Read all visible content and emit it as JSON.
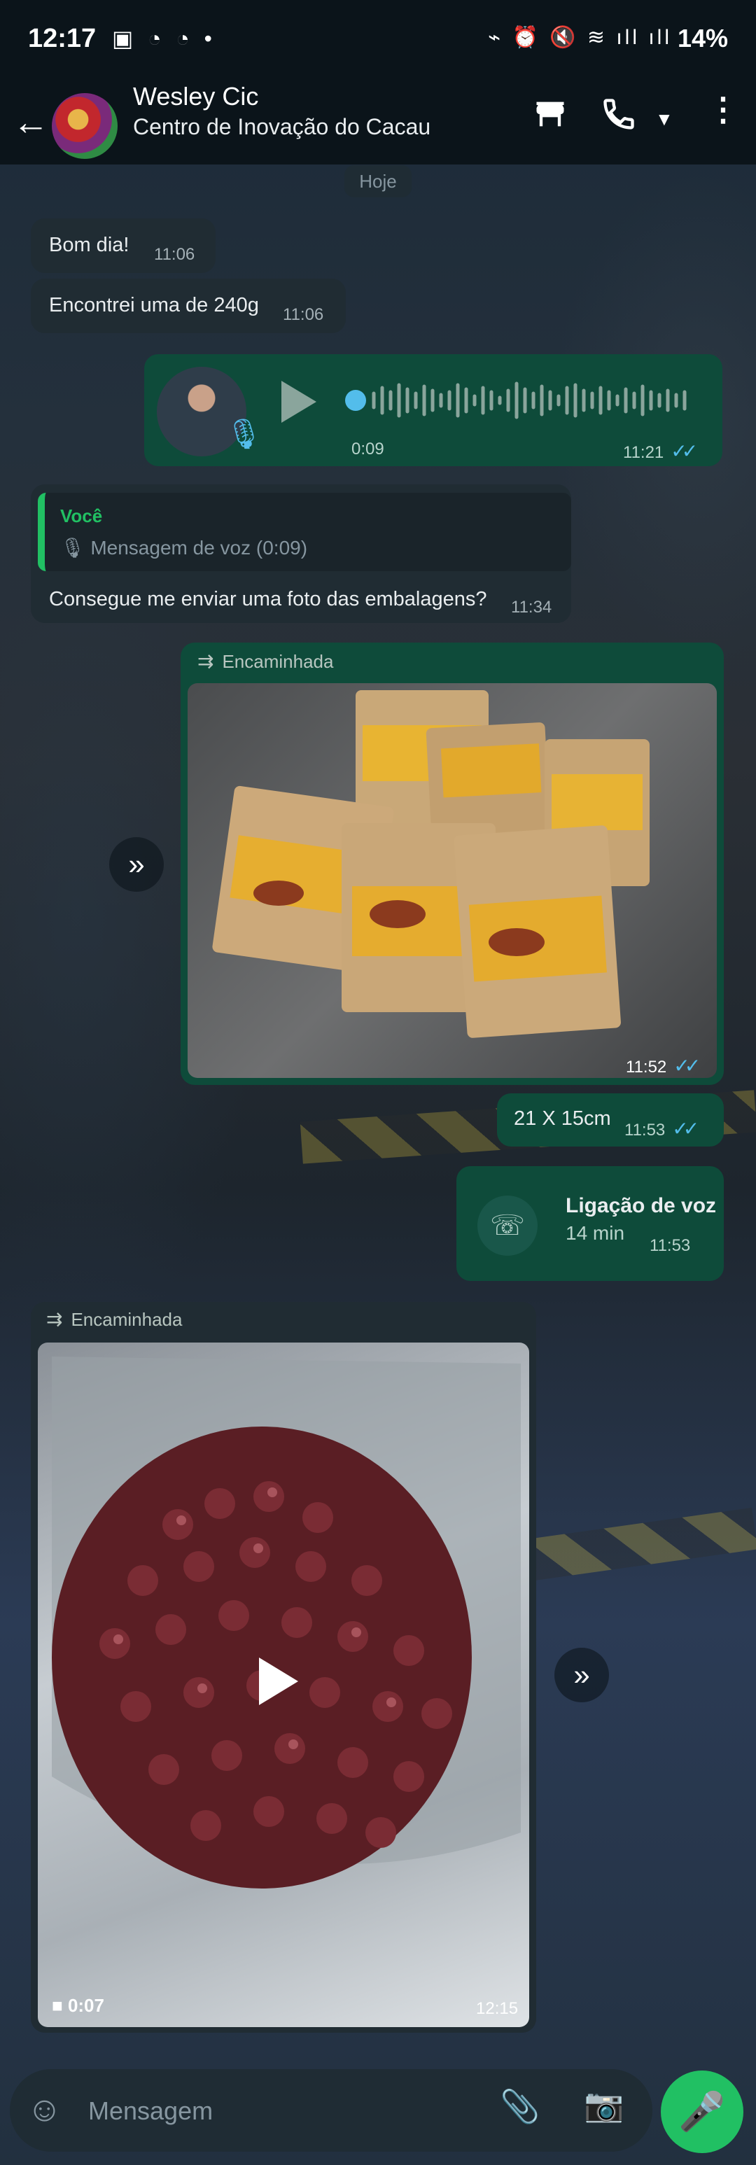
{
  "status_bar": {
    "time": "12:17",
    "battery": "14%"
  },
  "header": {
    "contact_name": "Wesley Cic",
    "subtitle": "Centro de Inovação do Cacau"
  },
  "date_chip": "Hoje",
  "messages": {
    "m1": {
      "text": "Bom dia!",
      "time": "11:06"
    },
    "m2": {
      "text": "Encontrei uma de 240g",
      "time": "11:06"
    },
    "voice": {
      "duration": "0:09",
      "time": "11:21"
    },
    "reply": {
      "quoted_author": "Você",
      "quoted_text": "Mensagem de voz (0:09)",
      "text": "Consegue me enviar uma foto das embalagens?",
      "time": "11:34"
    },
    "photo": {
      "forwarded_label": "Encaminhada",
      "time": "11:52"
    },
    "size": {
      "text": "21 X 15cm",
      "time": "11:53"
    },
    "call": {
      "title": "Ligação de voz",
      "duration": "14 min",
      "time": "11:53"
    },
    "video": {
      "forwarded_label": "Encaminhada",
      "duration": "0:07",
      "time": "12:15"
    }
  },
  "composer": {
    "placeholder": "Mensagem"
  },
  "colors": {
    "accent": "#21c063",
    "outgoing": "#0e4b3a",
    "incoming": "#202c33",
    "read_ticks": "#53bdeb"
  }
}
